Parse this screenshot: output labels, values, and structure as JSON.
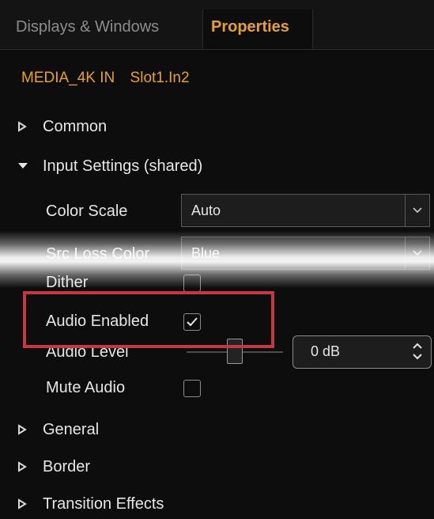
{
  "tabs": [
    {
      "label": "Displays & Windows",
      "active": false
    },
    {
      "label": "Properties",
      "active": true
    }
  ],
  "source": {
    "name": "MEDIA_4K IN",
    "slot": "Slot1.In2"
  },
  "sections": {
    "common": {
      "label": "Common",
      "expanded": false
    },
    "input_settings": {
      "label": "Input Settings (shared)",
      "expanded": true
    },
    "general": {
      "label": "General",
      "expanded": false
    },
    "border": {
      "label": "Border",
      "expanded": false
    },
    "transition": {
      "label": "Transition Effects",
      "expanded": false
    }
  },
  "input_settings": {
    "color_scale": {
      "label": "Color Scale",
      "value": "Auto"
    },
    "src_loss_color": {
      "label": "Src Loss Color",
      "value": "Blue"
    },
    "dither": {
      "label": "Dither",
      "checked": false
    },
    "audio_enabled": {
      "label": "Audio Enabled",
      "checked": true
    },
    "audio_level": {
      "label": "Audio Level",
      "value": "0 dB",
      "slider_fraction": 0.5
    },
    "mute_audio": {
      "label": "Mute Audio",
      "checked": false
    }
  },
  "colors": {
    "accent": "#e8a21f",
    "highlight": "#c7373f",
    "background": "#0d0d0d"
  },
  "icons": {
    "collapsed": "triangle-right-outline-icon",
    "expanded": "triangle-down-icon",
    "dropdown": "chevron-down-icon",
    "check": "checkmark-icon",
    "spin": "spin-arrows-icon"
  }
}
